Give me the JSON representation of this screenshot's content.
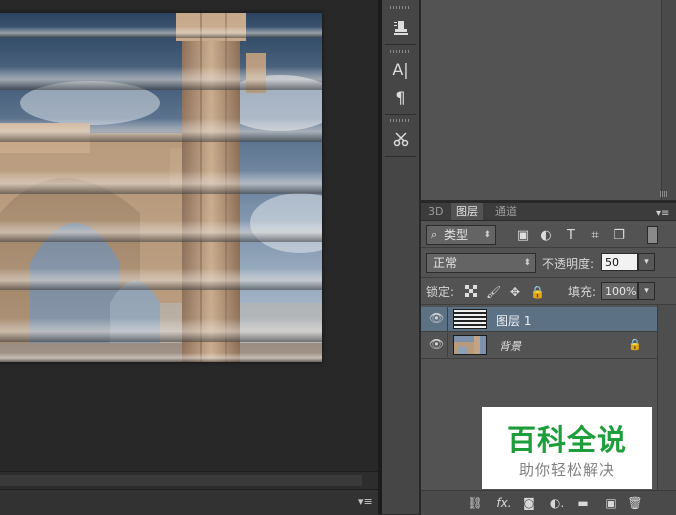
{
  "colors": {
    "panel_bg": "#535353",
    "canvas_bg": "#282828",
    "selected_layer": "#5d7185",
    "watermark_green": "#1e9e3b"
  },
  "icon_strip": {
    "items": [
      {
        "icon": "clone-source-icon"
      },
      {
        "icon": "character-icon",
        "glyph": "A|"
      },
      {
        "icon": "paragraph-icon",
        "glyph": "¶"
      },
      {
        "icon": "tool-presets-icon"
      }
    ]
  },
  "layers_panel": {
    "tabs": [
      {
        "label": "3D",
        "active": false
      },
      {
        "label": "图层",
        "active": true
      },
      {
        "label": "通道",
        "active": false
      }
    ],
    "filter": {
      "value": "类型",
      "icons": [
        "image-filter-icon",
        "adjustment-filter-icon",
        "type-filter-icon",
        "shape-filter-icon",
        "smart-object-filter-icon"
      ]
    },
    "blend_mode": "正常",
    "opacity": {
      "label": "不透明度:",
      "value": "50"
    },
    "lock": {
      "label": "锁定:",
      "icons": [
        "lock-transparent-icon",
        "lock-image-icon",
        "lock-position-icon",
        "lock-all-icon"
      ]
    },
    "fill": {
      "label": "填充:",
      "value": "100%"
    },
    "layers": [
      {
        "name": "图层 1",
        "selected": true,
        "visible": true
      },
      {
        "name": "背景",
        "selected": false,
        "visible": true,
        "locked": true
      }
    ],
    "bottom_icons": [
      {
        "icon": "link-layers-icon",
        "glyph": "⛓"
      },
      {
        "icon": "layer-style-icon",
        "glyph": "fx."
      },
      {
        "icon": "add-mask-icon",
        "glyph": "◙"
      },
      {
        "icon": "new-adjustment-layer-icon",
        "glyph": "◐."
      },
      {
        "icon": "new-group-icon",
        "glyph": "▬"
      },
      {
        "icon": "new-layer-icon",
        "glyph": "▣"
      },
      {
        "icon": "delete-layer-icon",
        "glyph": "🗑"
      }
    ]
  },
  "watermark": {
    "title": "百科全说",
    "subtitle": "助你轻松解决"
  }
}
